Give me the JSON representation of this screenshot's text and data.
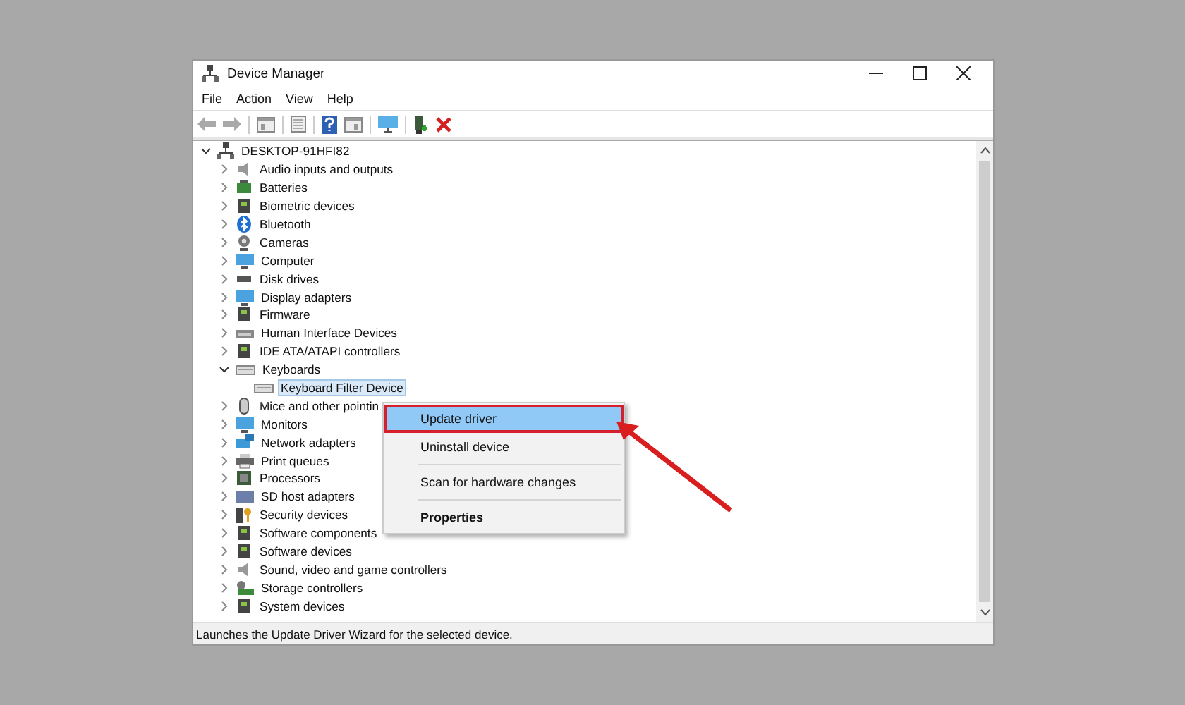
{
  "window": {
    "title": "Device Manager"
  },
  "menu_bar": [
    "File",
    "Action",
    "View",
    "Help"
  ],
  "tree": [
    {
      "label": "DESKTOP-91HFI82",
      "expanded": true,
      "selected": false,
      "children": [
        {
          "label": "Audio inputs and outputs",
          "expanded": false,
          "selected": false
        },
        {
          "label": "Batteries",
          "expanded": false,
          "selected": false
        },
        {
          "label": "Biometric devices",
          "expanded": false,
          "selected": false
        },
        {
          "label": "Bluetooth",
          "expanded": false,
          "selected": false
        },
        {
          "label": "Cameras",
          "expanded": false,
          "selected": false
        },
        {
          "label": "Computer",
          "expanded": false,
          "selected": false
        },
        {
          "label": "Disk drives",
          "expanded": false,
          "selected": false
        },
        {
          "label": "Display adapters",
          "expanded": false,
          "selected": false
        },
        {
          "label": "Firmware",
          "expanded": false,
          "selected": false
        },
        {
          "label": "Human Interface Devices",
          "expanded": false,
          "selected": false
        },
        {
          "label": "IDE ATA/ATAPI controllers",
          "expanded": false,
          "selected": false
        },
        {
          "label": "Keyboards",
          "expanded": true,
          "selected": false,
          "children": [
            {
              "label": "Keyboard Filter Device",
              "selected": true
            }
          ]
        },
        {
          "label": "Mice and other pointin",
          "expanded": false,
          "selected": false
        },
        {
          "label": "Monitors",
          "expanded": false,
          "selected": false
        },
        {
          "label": "Network adapters",
          "expanded": false,
          "selected": false
        },
        {
          "label": "Print queues",
          "expanded": false,
          "selected": false
        },
        {
          "label": "Processors",
          "expanded": false,
          "selected": false
        },
        {
          "label": "SD host adapters",
          "expanded": false,
          "selected": false
        },
        {
          "label": "Security devices",
          "expanded": false,
          "selected": false
        },
        {
          "label": "Software components",
          "expanded": false,
          "selected": false
        },
        {
          "label": "Software devices",
          "expanded": false,
          "selected": false
        },
        {
          "label": "Sound, video and game controllers",
          "expanded": false,
          "selected": false
        },
        {
          "label": "Storage controllers",
          "expanded": false,
          "selected": false
        },
        {
          "label": "System devices",
          "expanded": false,
          "selected": false
        }
      ]
    }
  ],
  "context_menu": [
    {
      "label": "Update driver",
      "selected": true,
      "default": false,
      "separator_before": false
    },
    {
      "label": "Uninstall device",
      "selected": false,
      "default": false,
      "separator_before": false
    },
    {
      "label": "Scan for hardware changes",
      "selected": false,
      "default": false,
      "separator_before": true
    },
    {
      "label": "Properties",
      "selected": false,
      "default": true,
      "separator_before": true
    }
  ],
  "status_bar": "Launches the Update Driver Wizard for the selected device."
}
